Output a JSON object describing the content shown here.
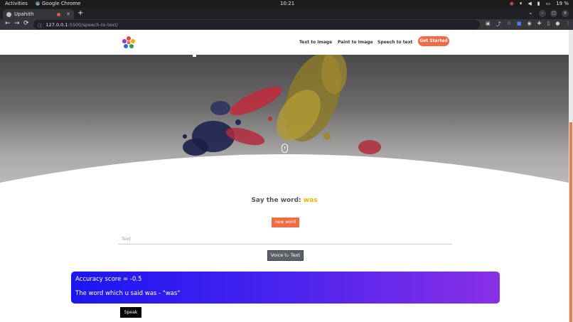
{
  "os_bar": {
    "activities": "Activities",
    "app_name": "Google Chrome",
    "clock": "10:21",
    "battery": "19 %"
  },
  "browser": {
    "tab_title": "Upahith",
    "url_host": "127.0.0.1",
    "url_path": ":5500/speech-to-text/",
    "nav": {
      "back": "←",
      "forward": "→",
      "reload": "⟳"
    }
  },
  "site": {
    "nav_items": [
      "Text to Image",
      "Paint to Image",
      "Speech to text"
    ],
    "cta_label": "Get Started"
  },
  "main": {
    "prompt_label": "Say the word:",
    "prompt_word": "was",
    "new_word_label": "new word",
    "text_placeholder": "Text",
    "voice_button_label": "Voice to Text",
    "result_line1": "Accuracy score = -0.5",
    "result_line2": "The word which u said was - \"was\"",
    "speak_label": "Speak"
  },
  "colors": {
    "accent": "#f06c45",
    "word_highlight": "#f0b400",
    "result_gradient_start": "#1a16f2",
    "result_gradient_end": "#8a30e6"
  }
}
